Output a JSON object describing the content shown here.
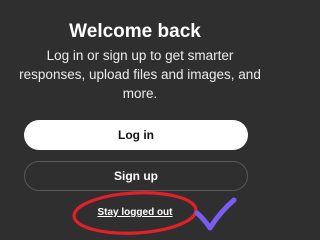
{
  "dialog": {
    "title": "Welcome back",
    "subtitle_lines": [
      "Log in or sign up to get smarter",
      "responses, upload files and images, and",
      "more."
    ]
  },
  "buttons": {
    "login_label": "Log in",
    "signup_label": "Sign up"
  },
  "links": {
    "stay_logged_out": "Stay logged out"
  },
  "annotations": {
    "circle_color": "#e3202a",
    "checkmark_color": "#7b5cf0",
    "checkmark_icon": "checkmark-icon"
  }
}
